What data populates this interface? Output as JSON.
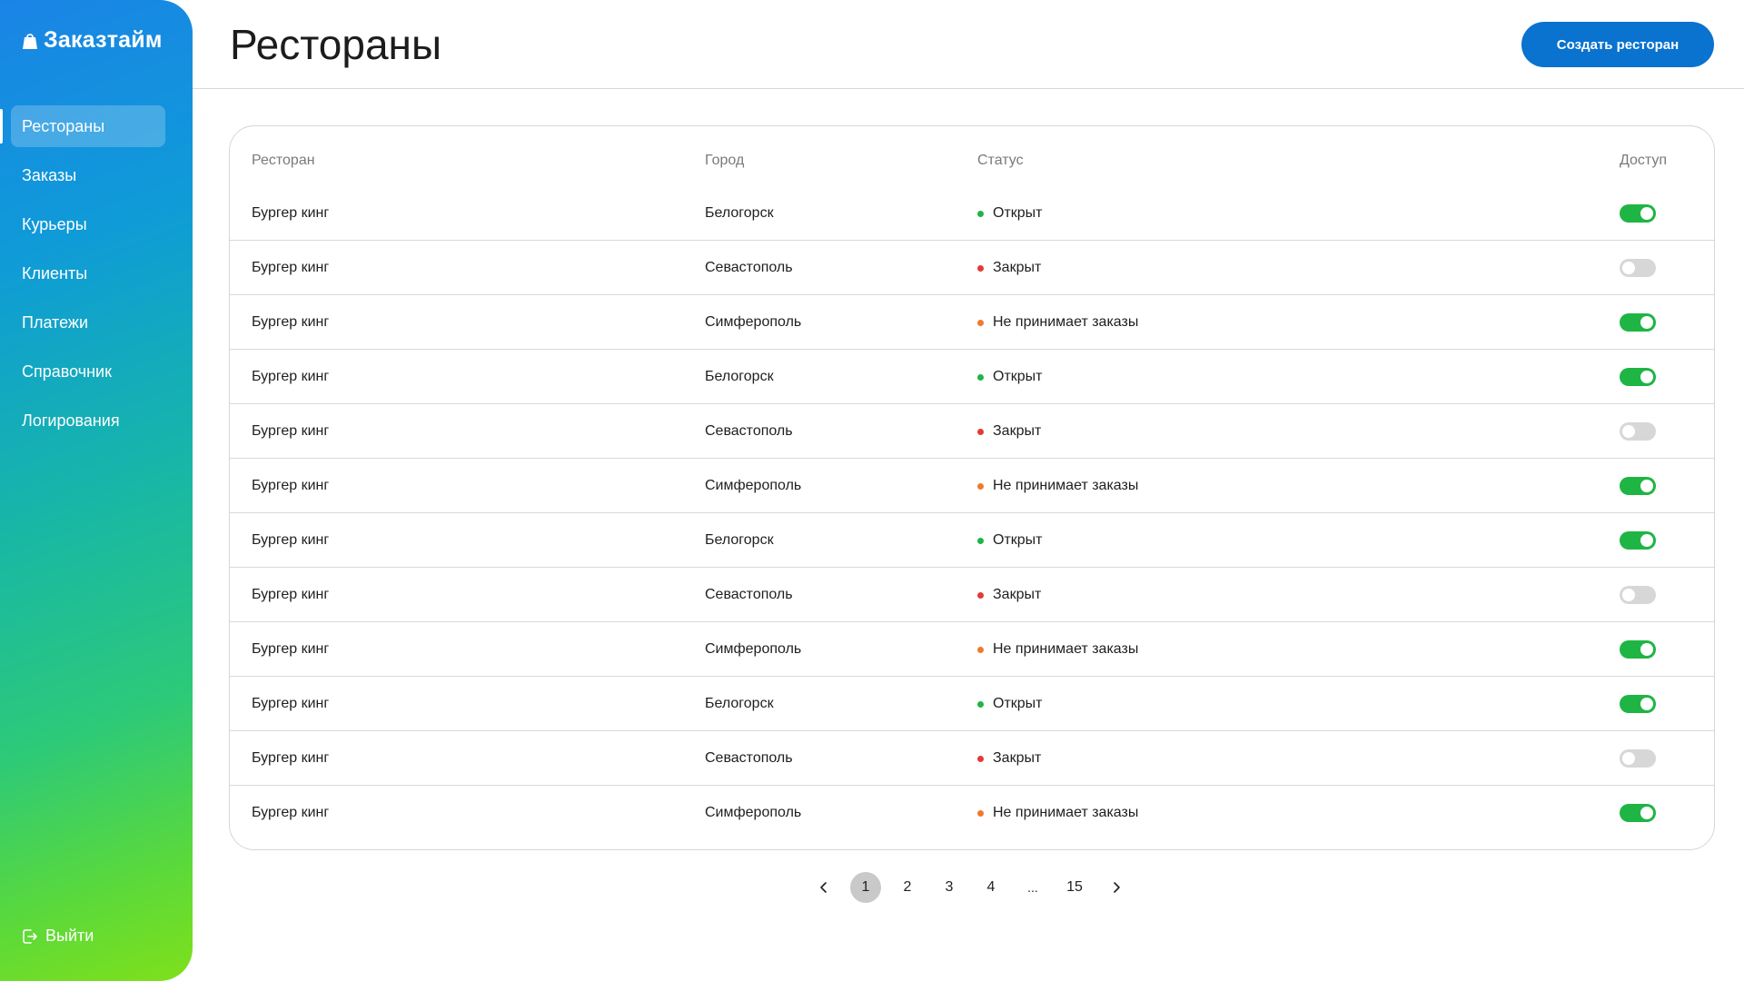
{
  "app": {
    "brand": "Заказтайм"
  },
  "sidebar": {
    "items": [
      {
        "label": "Рестораны",
        "active": true
      },
      {
        "label": "Заказы",
        "active": false
      },
      {
        "label": "Курьеры",
        "active": false
      },
      {
        "label": "Клиенты",
        "active": false
      },
      {
        "label": "Платежи",
        "active": false
      },
      {
        "label": "Справочник",
        "active": false
      },
      {
        "label": "Логирования",
        "active": false
      }
    ],
    "logout_label": "Выйти"
  },
  "header": {
    "title": "Рестораны",
    "create_button": "Создать ресторан"
  },
  "colors": {
    "accent": "#0a72cf",
    "status_open": "#1fb545",
    "status_closed": "#e53935",
    "status_not_accepting": "#f07a2a",
    "toggle_on": "#1fb545",
    "toggle_off": "#d7d7d7"
  },
  "table": {
    "columns": {
      "restaurant": "Ресторан",
      "city": "Город",
      "status": "Статус",
      "access": "Доступ"
    },
    "rows": [
      {
        "name": "Бургер кинг",
        "city": "Белогорск",
        "status": "Открыт",
        "status_color": "#1fb545",
        "access": true
      },
      {
        "name": "Бургер кинг",
        "city": "Севастополь",
        "status": "Закрыт",
        "status_color": "#e53935",
        "access": false
      },
      {
        "name": "Бургер кинг",
        "city": "Симферополь",
        "status": "Не принимает заказы",
        "status_color": "#f07a2a",
        "access": true
      },
      {
        "name": "Бургер кинг",
        "city": "Белогорск",
        "status": "Открыт",
        "status_color": "#1fb545",
        "access": true
      },
      {
        "name": "Бургер кинг",
        "city": "Севастополь",
        "status": "Закрыт",
        "status_color": "#e53935",
        "access": false
      },
      {
        "name": "Бургер кинг",
        "city": "Симферополь",
        "status": "Не принимает заказы",
        "status_color": "#f07a2a",
        "access": true
      },
      {
        "name": "Бургер кинг",
        "city": "Белогорск",
        "status": "Открыт",
        "status_color": "#1fb545",
        "access": true
      },
      {
        "name": "Бургер кинг",
        "city": "Севастополь",
        "status": "Закрыт",
        "status_color": "#e53935",
        "access": false
      },
      {
        "name": "Бургер кинг",
        "city": "Симферополь",
        "status": "Не принимает заказы",
        "status_color": "#f07a2a",
        "access": true
      },
      {
        "name": "Бургер кинг",
        "city": "Белогорск",
        "status": "Открыт",
        "status_color": "#1fb545",
        "access": true
      },
      {
        "name": "Бургер кинг",
        "city": "Севастополь",
        "status": "Закрыт",
        "status_color": "#e53935",
        "access": false
      },
      {
        "name": "Бургер кинг",
        "city": "Симферополь",
        "status": "Не принимает заказы",
        "status_color": "#f07a2a",
        "access": true
      }
    ]
  },
  "pagination": {
    "pages": [
      "1",
      "2",
      "3",
      "4"
    ],
    "ellipsis": "...",
    "last_page": "15",
    "current": "1",
    "prev_icon": "chevron-left-icon",
    "next_icon": "chevron-right-icon"
  }
}
